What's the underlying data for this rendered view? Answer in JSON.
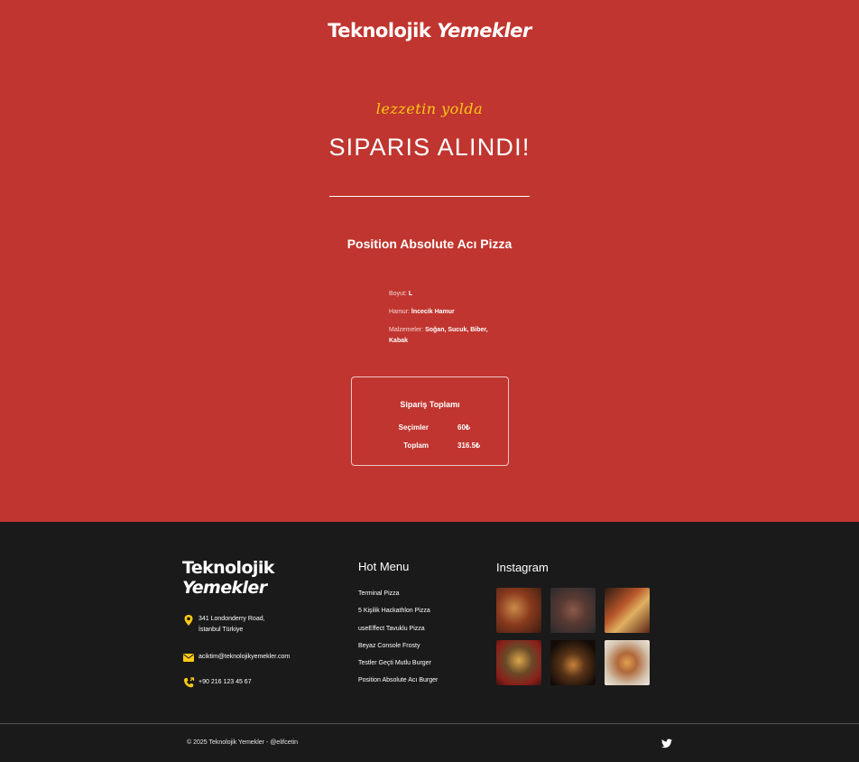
{
  "header": {
    "brand_part1": "Teknolojik",
    "brand_part2": "Yemekler",
    "tagline": "lezzetin yolda",
    "headline": "SIPARIS ALINDI!"
  },
  "order": {
    "product_name": "Position Absolute Acı Pizza",
    "details": [
      {
        "label": "Boyut:",
        "value": "L"
      },
      {
        "label": "Hamur:",
        "value": "İncecik Hamur"
      },
      {
        "label": "Malzemeler:",
        "value": "Soğan, Sucuk, Biber, Kabak"
      }
    ],
    "summary": {
      "title": "Sipariş Toplamı",
      "rows": [
        {
          "label": "Seçimler",
          "value": "60₺"
        },
        {
          "label": "Toplam",
          "value": "316.5₺"
        }
      ]
    }
  },
  "footer": {
    "brand_part1": "Teknolojik",
    "brand_part2": "Yemekler",
    "address": "341 Londonderry Road, İstanbul Türkiye",
    "email": "aciktim@teknolojikyemekler.com",
    "phone": "+90 216 123 45 67",
    "hot_menu_title": "Hot Menu",
    "hot_menu": [
      "Terminal Pizza",
      "5 Kişilik Hackathlon Pizza",
      "useEffect Tavuklu Pizza",
      "Beyaz Console Frosty",
      "Testler Geçti Mutlu Burger",
      "Position Absolute Acı Burger"
    ],
    "instagram_title": "Instagram",
    "instagram_images": [
      "pizza-slices-photo",
      "grilled-skewers-photo",
      "pizza-rolls-photo",
      "burger-fries-photo",
      "dark-burger-photo",
      "cheeseburger-photo"
    ],
    "copyright": "© 2025 Teknolojik Yemekler - @elifcetin",
    "social_icon": "twitter-icon"
  },
  "colors": {
    "primary_red": "#c0352f",
    "accent_yellow": "#fdc913",
    "footer_bg": "#1a1a1a"
  }
}
